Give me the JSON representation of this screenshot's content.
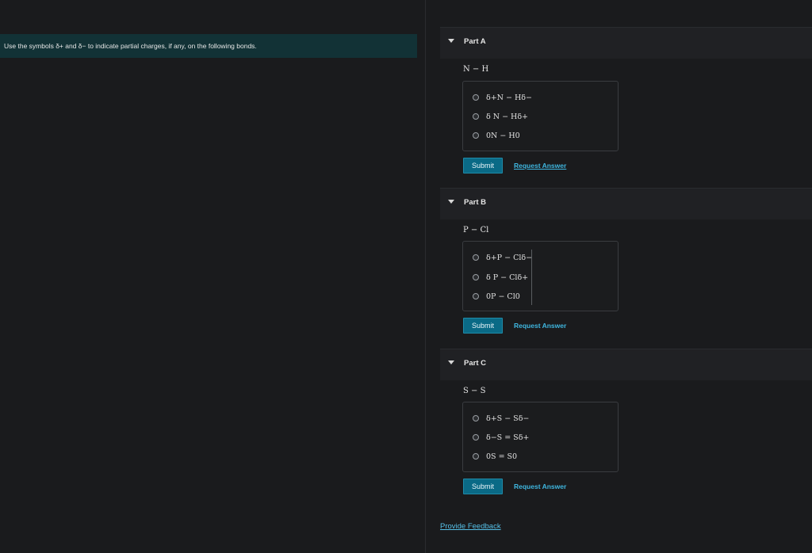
{
  "instruction": "Use the symbols δ+ and δ− to indicate partial charges, if any, on the following bonds.",
  "parts": [
    {
      "title": "Part A",
      "formula": "N − H",
      "options": [
        "δ+N − Hδ−",
        "δ  N − Hδ+",
        "0N − H0"
      ],
      "submit": "Submit",
      "request": "Request Answer"
    },
    {
      "title": "Part B",
      "formula": "P − Cl",
      "options": [
        "δ+P − Clδ−",
        "δ  P − Clδ+",
        "0P − Cl0"
      ],
      "submit": "Submit",
      "request": "Request Answer"
    },
    {
      "title": "Part C",
      "formula": "S − S",
      "options": [
        "δ+S − Sδ−",
        "δ−S = Sδ+",
        "0S = S0"
      ],
      "submit": "Submit",
      "request": "Request Answer"
    }
  ],
  "feedback": "Provide Feedback"
}
